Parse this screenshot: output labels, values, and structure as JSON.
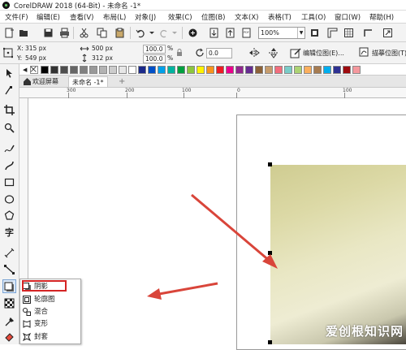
{
  "app": {
    "title": "CorelDRAW 2018 (64-Bit) - 未命名 -1*"
  },
  "menu": [
    "文件(F)",
    "编辑(E)",
    "查看(V)",
    "布局(L)",
    "对象(J)",
    "效果(C)",
    "位图(B)",
    "文本(X)",
    "表格(T)",
    "工具(O)",
    "窗口(W)",
    "帮助(H)"
  ],
  "toolbar": {
    "zoom_value": "100%"
  },
  "propbar": {
    "x_label": "X:",
    "x_value": "315 px",
    "y_label": "Y:",
    "y_value": "549 px",
    "w_value": "500 px",
    "h_value": "312 px",
    "scale_w": "100.0",
    "scale_h": "100.0",
    "pct": "%",
    "rotation": "0.0",
    "edit_bitmap": "编辑位图(E)...",
    "trace_bitmap": "描摹位图(T)"
  },
  "tabs": {
    "welcome": "欢迎屏幕",
    "doc": "未命名 -1*",
    "add": "+"
  },
  "ruler": {
    "marks": [
      "300",
      "200",
      "100",
      "0",
      "100"
    ]
  },
  "flyout": {
    "items": [
      {
        "label": "阴影",
        "icon": "drop-shadow-icon"
      },
      {
        "label": "轮廓图",
        "icon": "contour-icon"
      },
      {
        "label": "混合",
        "icon": "blend-icon"
      },
      {
        "label": "变形",
        "icon": "distort-icon"
      },
      {
        "label": "封套",
        "icon": "envelope-icon"
      }
    ]
  },
  "watermark": "爱创根知识网",
  "colors": {
    "highlight": "#d42424",
    "arrow": "#d9453a",
    "accent": "#7aa3d4"
  },
  "palette": [
    "#000000",
    "#333333",
    "#4d4d4d",
    "#666666",
    "#808080",
    "#999999",
    "#b3b3b3",
    "#cccccc",
    "#e6e6e6",
    "#ffffff",
    "#1b2a8a",
    "#0050c8",
    "#00a0e9",
    "#00b4a0",
    "#00a040",
    "#8cc63f",
    "#fff200",
    "#f7941d",
    "#ed1c24",
    "#ec008c",
    "#92278f",
    "#662d91",
    "#8c6239",
    "#c69c6d",
    "#f26d7d",
    "#7accc8",
    "#acd373",
    "#fbaf5d",
    "#a67c52",
    "#00aeef",
    "#2e3192",
    "#9e0b0f",
    "#f5989d"
  ]
}
